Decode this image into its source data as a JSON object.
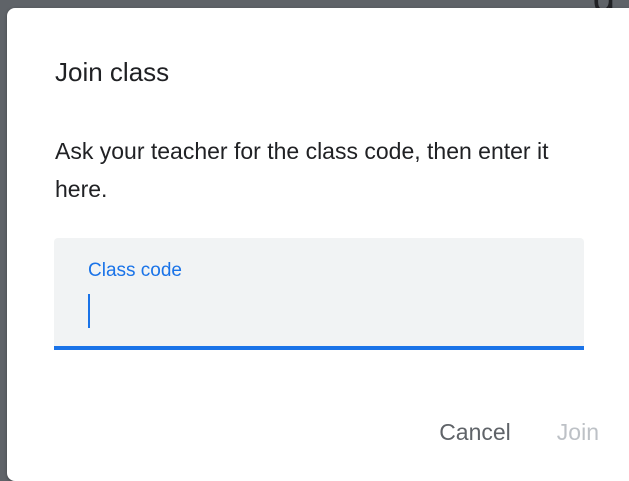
{
  "dialog": {
    "title": "Join class",
    "instructions": "Ask your teacher for the class code, then enter it here.",
    "field": {
      "label": "Class code",
      "value": ""
    },
    "actions": {
      "cancel_label": "Cancel",
      "join_label": "Join"
    }
  },
  "backdrop": {
    "glyph": "g"
  },
  "colors": {
    "accent": "#1a73e8",
    "field_background": "#f1f3f4",
    "text_primary": "#202124",
    "text_secondary": "#5f6368",
    "disabled": "#bdc1c6"
  }
}
